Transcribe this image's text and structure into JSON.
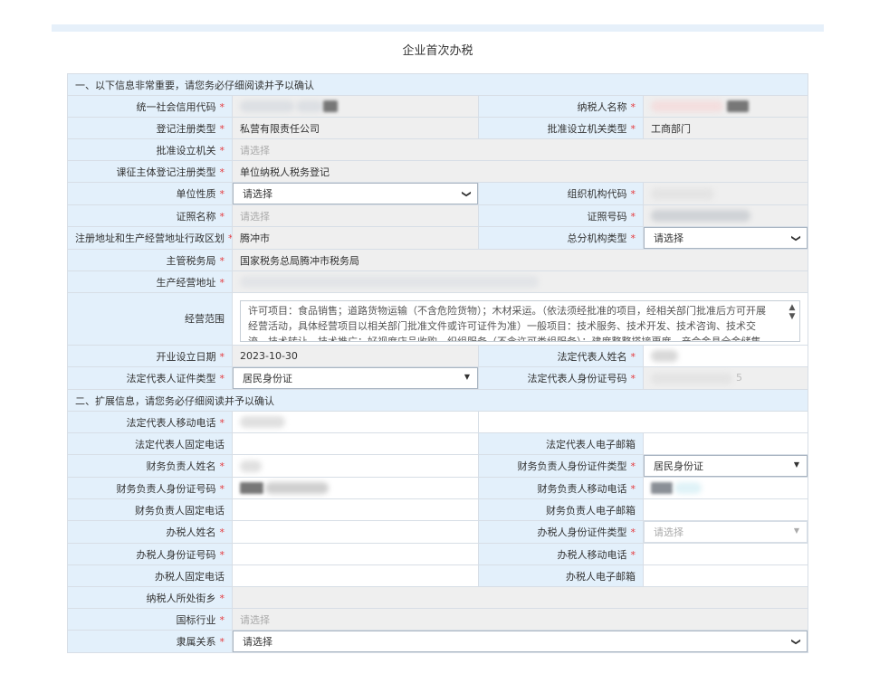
{
  "title": "企业首次办税",
  "sections": {
    "one": "一、以下信息非常重要，请您务必仔细阅读并予以确认",
    "two": "二、扩展信息，请您务必仔细阅读并予以确认"
  },
  "required_mark": "*",
  "placeholder": "请选择",
  "labels": {
    "credit_code": "统一社会信用代码",
    "taxpayer_name": "纳税人名称",
    "reg_type": "登记注册类型",
    "approval_org_type": "批准设立机关类型",
    "approval_org": "批准设立机关",
    "levy_reg_type": "课征主体登记注册类型",
    "unit_nature": "单位性质",
    "org_code": "组织机构代码",
    "cert_name": "证照名称",
    "cert_no": "证照号码",
    "district": "注册地址和生产经营地址行政区划",
    "head_org_type": "总分机构类型",
    "tax_bureau": "主管税务局",
    "address": "生产经营地址",
    "scope": "经营范围",
    "open_date": "开业设立日期",
    "legal_name": "法定代表人姓名",
    "legal_id_type": "法定代表人证件类型",
    "legal_id_no": "法定代表人身份证号码",
    "legal_mobile": "法定代表人移动电话",
    "legal_phone": "法定代表人固定电话",
    "legal_email": "法定代表人电子邮箱",
    "fin_name": "财务负责人姓名",
    "fin_id_type": "财务负责人身份证件类型",
    "fin_id_no": "财务负责人身份证号码",
    "fin_mobile": "财务负责人移动电话",
    "fin_phone": "财务负责人固定电话",
    "fin_email": "财务负责人电子邮箱",
    "agent_name": "办税人姓名",
    "agent_id_type": "办税人身份证件类型",
    "agent_id_no": "办税人身份证号码",
    "agent_mobile": "办税人移动电话",
    "agent_phone": "办税人固定电话",
    "agent_email": "办税人电子邮箱",
    "street": "纳税人所处街乡",
    "industry": "国标行业",
    "affiliation": "隶属关系"
  },
  "values": {
    "reg_type": "私营有限责任公司",
    "approval_org_type": "工商部门",
    "levy_reg_type": "单位纳税人税务登记",
    "district": "腾冲市",
    "tax_bureau": "国家税务总局腾冲市税务局",
    "scope": "许可项目：食品销售；道路货物运输（不含危险货物）；木材采运。（依法须经批准的项目，经相关部门批准后方可开展经营活动，具体经营项目以相关部门批准文件或许可证件为准）一般项目：技术服务、技术开发、技术咨询、技术交流、技术转让、技术推广；好视度店品收购，织组服务（不含许可类组服务）；建度整整搭接更度，产会金具全金储集，店城鲜度鱼",
    "open_date": "2023-10-30",
    "legal_id_type": "居民身份证",
    "legal_id_no_tail": "5",
    "fin_id_type": "居民身份证"
  },
  "colors": {
    "label_bg": "#e3f0fb",
    "readonly_bg": "#efefef",
    "border": "#d7dee6",
    "required": "#e4393c"
  }
}
